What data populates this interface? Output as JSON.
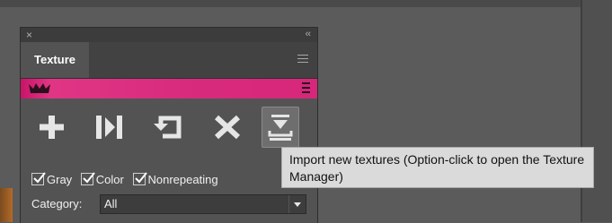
{
  "panel": {
    "close_glyph": "×",
    "collapse_glyph": "‹‹",
    "tab_label": "Texture",
    "menu_icon": "hamburger-icon"
  },
  "banner": {
    "color": "#d7277b",
    "logo_icon": "crown-icon",
    "menu_icon": "hamburger-icon"
  },
  "toolbar": {
    "buttons": [
      {
        "name": "add",
        "icon": "plus-icon"
      },
      {
        "name": "load",
        "icon": "load-arrow-icon"
      },
      {
        "name": "refresh",
        "icon": "refresh-icon"
      },
      {
        "name": "delete",
        "icon": "x-icon"
      },
      {
        "name": "import",
        "icon": "import-icon",
        "active": true
      }
    ]
  },
  "filters": {
    "gray": {
      "label": "Gray",
      "checked": true
    },
    "color": {
      "label": "Color",
      "checked": true
    },
    "nonrepeating": {
      "label": "Nonrepeating",
      "checked": true
    }
  },
  "category": {
    "label": "Category:",
    "value": "All"
  },
  "tooltip": {
    "text": "Import new textures (Option-click to open the Texture Manager)"
  }
}
